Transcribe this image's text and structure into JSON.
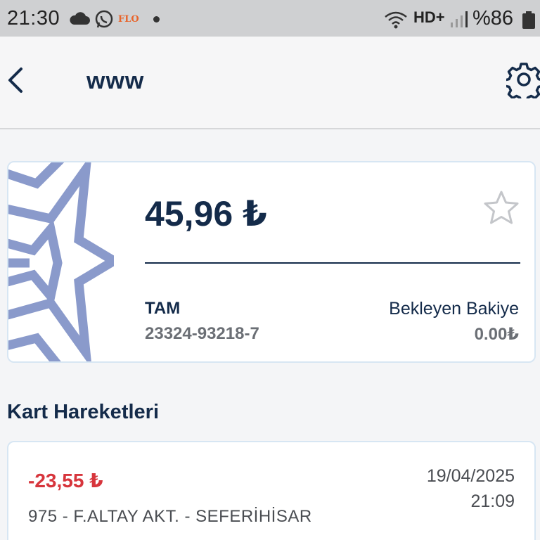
{
  "status_bar": {
    "time": "21:30",
    "app_badge": "FLO",
    "network": "HD+",
    "battery": "%86"
  },
  "app_bar": {
    "title": "www"
  },
  "balance_card": {
    "amount": "45,96 ₺",
    "card_type": "TAM",
    "card_number": "23324-93218-7",
    "pending_label": "Bekleyen Bakiye",
    "pending_value": "0.00₺"
  },
  "section_title": "Kart Hareketleri",
  "transactions": [
    {
      "amount": "-23,55 ₺",
      "date": "19/04/2025",
      "time": "21:09",
      "description": "975 - F.ALTAY AKT. - SEFERİHİSAR"
    }
  ],
  "colors": {
    "primary": "#142b4a",
    "negative": "#d7353c",
    "pattern": "#8a9acb",
    "card_border": "#d7e6f3"
  },
  "icons": [
    "cloud-icon",
    "whatsapp-icon",
    "wifi-icon",
    "signal-icon",
    "battery-icon",
    "back-arrow-icon",
    "gear-icon",
    "star-icon"
  ]
}
